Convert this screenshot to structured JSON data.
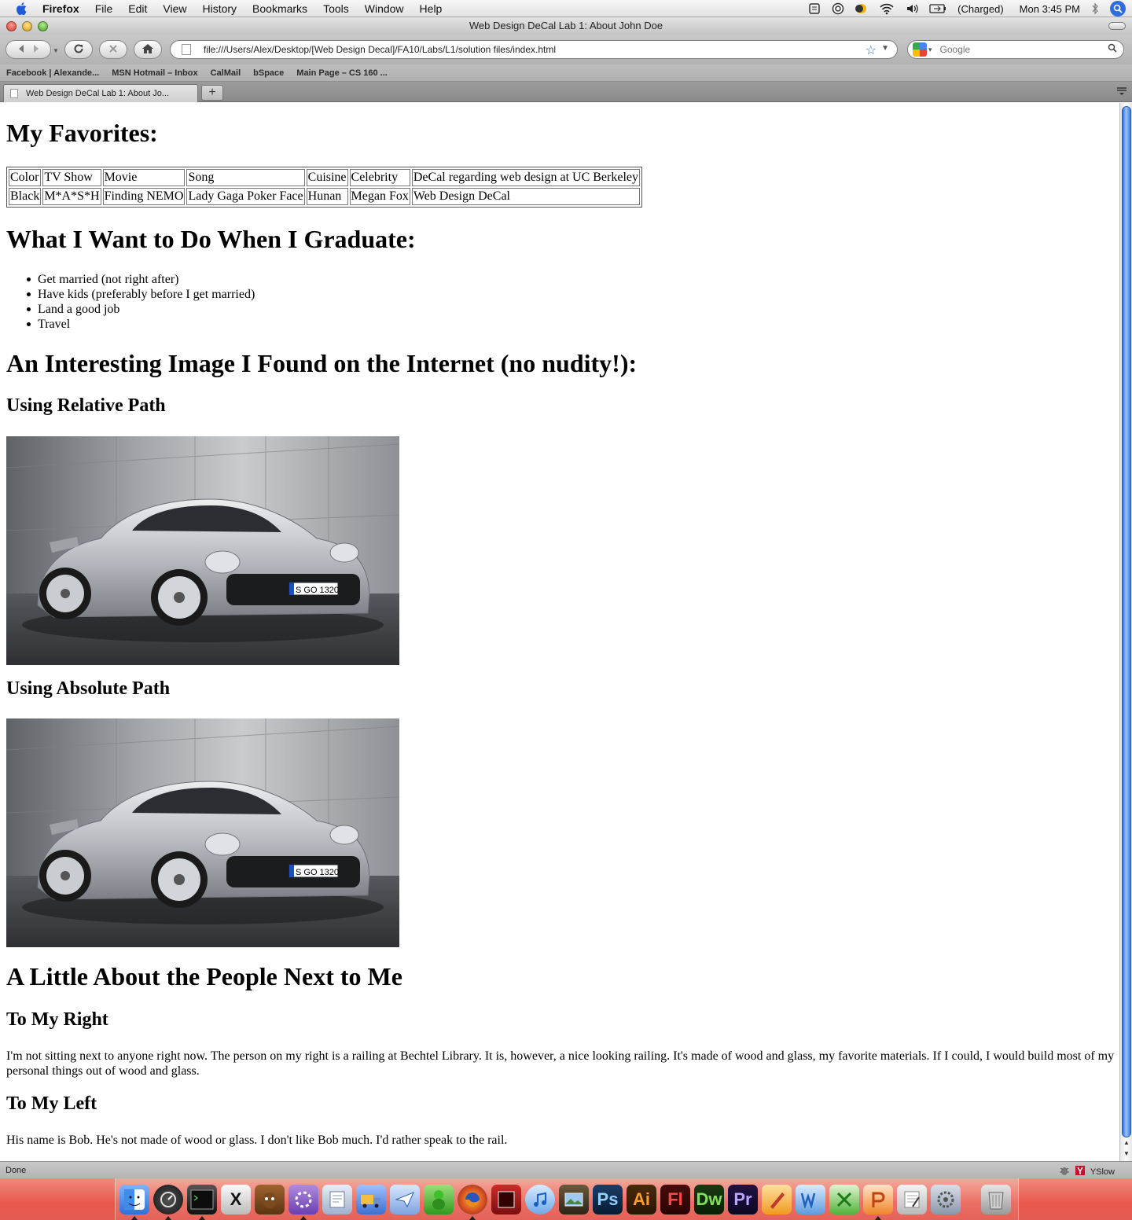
{
  "menubar": {
    "app": "Firefox",
    "items": [
      "File",
      "Edit",
      "View",
      "History",
      "Bookmarks",
      "Tools",
      "Window",
      "Help"
    ],
    "battery": "(Charged)",
    "clock": "Mon 3:45 PM"
  },
  "window": {
    "title": "Web Design DeCal Lab 1: About John Doe"
  },
  "navbar": {
    "url": "file:///Users/Alex/Desktop/[Web Design Decal]/FA10/Labs/L1/solution files/index.html",
    "search_placeholder": "Google"
  },
  "bookmarks": [
    "Facebook | Alexande...",
    "MSN Hotmail – Inbox",
    "CalMail",
    "bSpace",
    "Main Page – CS 160 ..."
  ],
  "tabs": [
    {
      "label": "Web Design DeCal Lab 1: About Jo...",
      "active": true
    }
  ],
  "page": {
    "favorites_heading": "My Favorites:",
    "favorites": {
      "headers": [
        "Color",
        "TV Show",
        "Movie",
        "Song",
        "Cuisine",
        "Celebrity",
        "DeCal regarding web design at UC Berkeley"
      ],
      "values": [
        "Black",
        "M*A*S*H",
        "Finding NEMO",
        "Lady Gaga Poker Face",
        "Hunan",
        "Megan Fox",
        "Web Design DeCal"
      ]
    },
    "graduate_heading": "What I Want to Do When I Graduate:",
    "goals": [
      "Get married (not right after)",
      "Have kids (preferably before I get married)",
      "Land a good job",
      "Travel"
    ],
    "image_heading": "An Interesting Image I Found on the Internet (no nudity!):",
    "relative_heading": "Using Relative Path",
    "absolute_heading": "Using Absolute Path",
    "plate_text": "S GO 1320",
    "people_heading": "A Little About the People Next to Me",
    "right_heading": "To My Right",
    "right_text": "I'm not sitting next to anyone right now. The person on my right is a railing at Bechtel Library. It is, however, a nice looking railing. It's made of wood and glass, my favorite materials. If I could, I would build most of my personal things out of wood and glass.",
    "left_heading": "To My Left",
    "left_text": "His name is Bob. He's not made of wood or glass. I don't like Bob much. I'd rather speak to the rail."
  },
  "statusbar": {
    "status": "Done",
    "yslow": "YSlow"
  },
  "dock": {
    "labels": [
      "X",
      "Ps",
      "Ai",
      "Fl",
      "Dw",
      "Pr"
    ]
  },
  "colors": {
    "dock": "#e8584d",
    "scroll_thumb": "#3a7fe0"
  }
}
